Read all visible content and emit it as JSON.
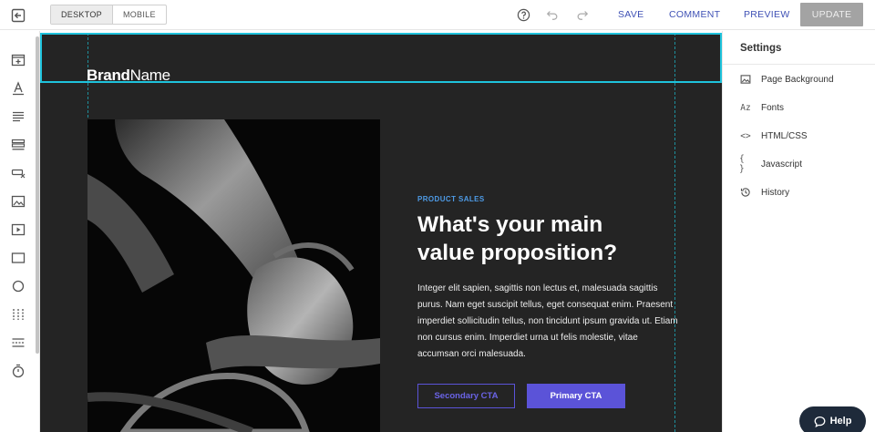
{
  "topbar": {
    "device_toggle": {
      "desktop": "DESKTOP",
      "mobile": "MOBILE"
    },
    "actions": {
      "save": "SAVE",
      "comment": "COMMENT",
      "preview": "PREVIEW",
      "update": "UPDATE"
    },
    "icons": [
      "exit-icon",
      "help-circle-icon",
      "undo-icon",
      "redo-icon"
    ]
  },
  "left_toolbar": {
    "tools": [
      "section-icon",
      "text-icon",
      "paragraph-icon",
      "list-icon",
      "form-icon",
      "image-icon",
      "video-icon",
      "box-icon",
      "circle-icon",
      "columns-icon",
      "divider-icon",
      "timer-icon"
    ]
  },
  "canvas": {
    "brand_bold": "Brand",
    "brand_regular": "Name",
    "eyebrow": "PRODUCT SALES",
    "headline_line1": "What's your main",
    "headline_line2": "value proposition?",
    "body": "Integer elit sapien, sagittis non lectus et, malesuada sagittis purus. Nam eget suscipit tellus, eget consequat enim. Praesent imperdiet sollicitudin tellus, non tincidunt ipsum gravida ut. Etiam non cursus enim. Imperdiet urna ut felis molestie, vitae accumsan orci malesuada.",
    "secondary_cta": "Secondary CTA",
    "primary_cta": "Primary CTA",
    "colors": {
      "background": "#242424",
      "accent": "#5b53d8",
      "eyebrow": "#4e9be6",
      "selection": "#1fc3dc"
    }
  },
  "settings": {
    "title": "Settings",
    "items": [
      {
        "label": "Page Background",
        "icon": "image-icon"
      },
      {
        "label": "Fonts",
        "icon": "fonts-icon",
        "glyph": "Az"
      },
      {
        "label": "HTML/CSS",
        "icon": "code-icon",
        "glyph": "<>"
      },
      {
        "label": "Javascript",
        "icon": "braces-icon",
        "glyph": "{ }"
      },
      {
        "label": "History",
        "icon": "history-icon"
      }
    ]
  },
  "help": {
    "label": "Help"
  }
}
